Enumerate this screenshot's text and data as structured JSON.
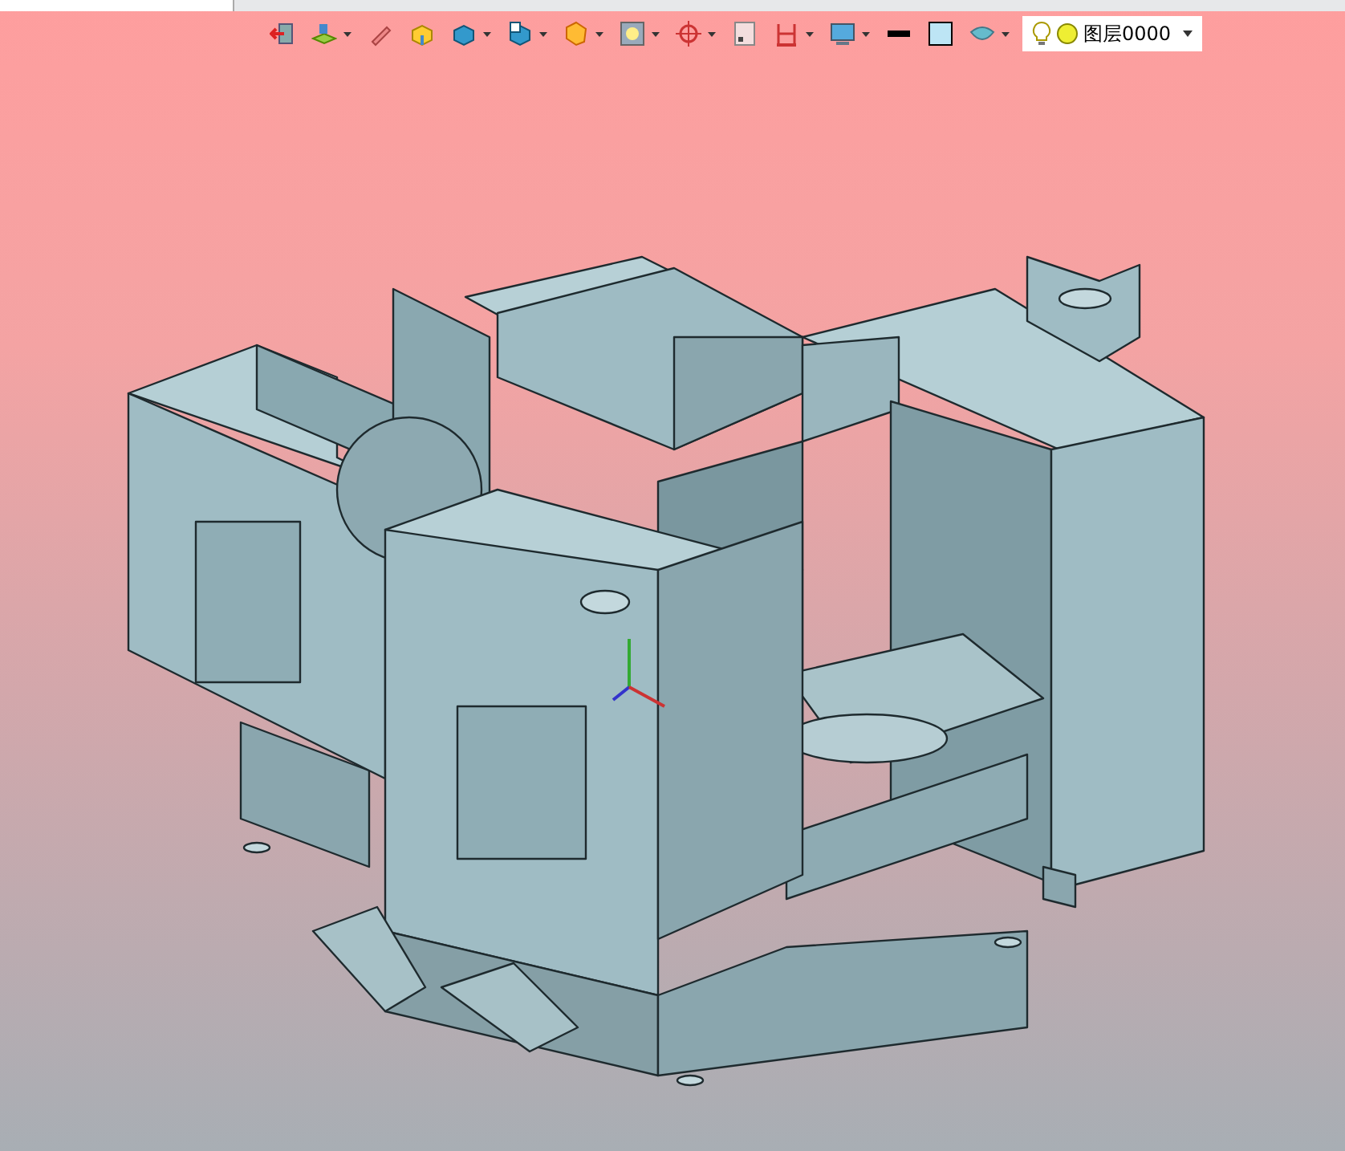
{
  "toolbar": {
    "tools": [
      {
        "menu": false
      },
      {
        "menu": true
      },
      {
        "menu": false
      },
      {
        "menu": false
      },
      {
        "menu": true
      },
      {
        "menu": true
      },
      {
        "menu": true
      },
      {
        "menu": true
      },
      {
        "menu": true
      },
      {
        "menu": false
      },
      {
        "menu": true
      },
      {
        "menu": true
      },
      {
        "menu": false
      },
      {
        "menu": false
      },
      {
        "menu": true
      }
    ],
    "layer": {
      "value": "图层0000"
    }
  }
}
